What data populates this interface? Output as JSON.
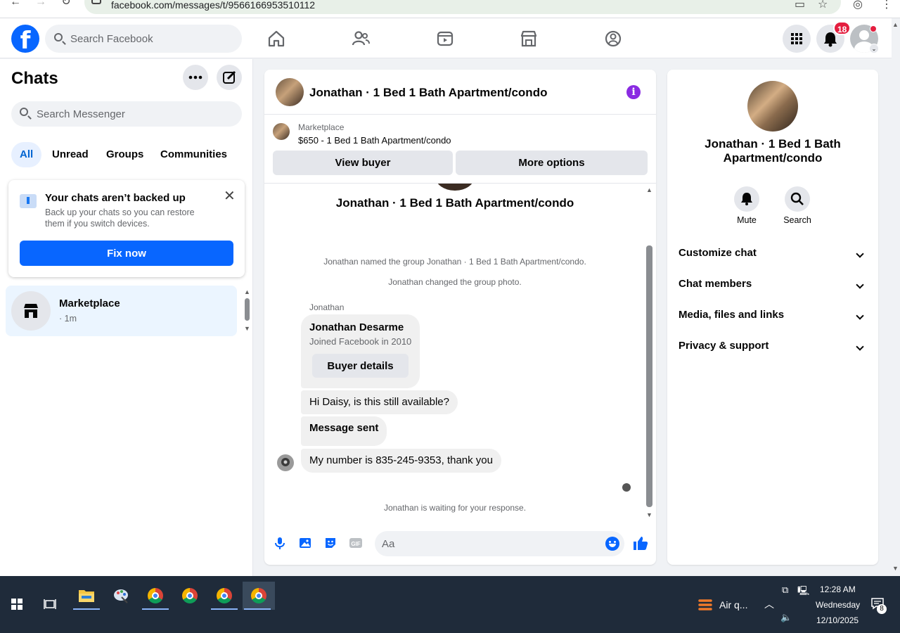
{
  "browser": {
    "url": "facebook.com/messages/t/9566166953510112"
  },
  "topbar": {
    "search_placeholder": "Search Facebook",
    "notification_count": "18"
  },
  "sidebar": {
    "title": "Chats",
    "search_placeholder": "Search Messenger",
    "filters": [
      "All",
      "Unread",
      "Groups",
      "Communities"
    ],
    "backup": {
      "title": "Your chats aren’t backed up",
      "text": "Back up your chats so you can restore them if you switch devices.",
      "button": "Fix now"
    },
    "conversation": {
      "name": "Marketplace",
      "meta": "· 1m"
    }
  },
  "chat": {
    "header_name": "Jonathan · 1 Bed 1 Bath Apartment/condo",
    "marketplace_label": "Marketplace",
    "listing": "$650 - 1 Bed 1 Bath Apartment/condo",
    "view_buyer": "View buyer",
    "more_options": "More options",
    "group_title": "Jonathan · 1 Bed 1 Bath Apartment/condo",
    "system_messages": [
      "Jonathan named the group Jonathan · 1 Bed 1 Bath Apartment/condo.",
      "Jonathan changed the group photo."
    ],
    "sender": "Jonathan",
    "buyer_card": {
      "name": "Jonathan Desarme",
      "joined": "Joined Facebook in 2010",
      "button": "Buyer details"
    },
    "messages": [
      "Hi Daisy, is this still available?",
      "Message sent",
      "My number is 835-245-9353, thank you"
    ],
    "waiting": "Jonathan is waiting for your response.",
    "composer_placeholder": "Aa"
  },
  "right_panel": {
    "name": "Jonathan · 1 Bed 1 Bath Apartment/condo",
    "actions": [
      "Mute",
      "Search"
    ],
    "sections": [
      "Customize chat",
      "Chat members",
      "Media, files and links",
      "Privacy & support"
    ]
  },
  "taskbar": {
    "weather": "Air q...",
    "time": "12:28 AM",
    "day": "Wednesday",
    "date": "12/10/2025",
    "notification_count": "8"
  }
}
